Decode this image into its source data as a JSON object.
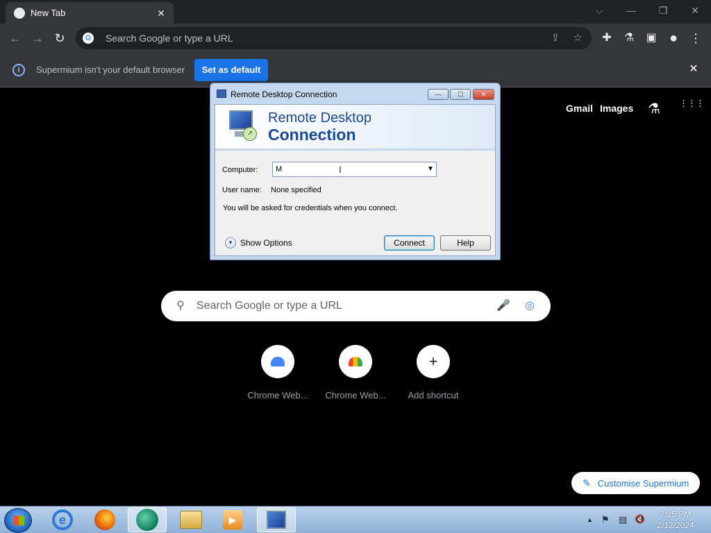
{
  "browser": {
    "tab": {
      "title": "New Tab",
      "close_symbol": "✕"
    },
    "window_controls": {
      "dropdown": "⌵",
      "minimize": "—",
      "restore": "❐",
      "close": "✕"
    },
    "toolbar": {
      "back": "←",
      "forward": "→",
      "reload": "↻",
      "omnibox_placeholder": "Search Google or type a URL",
      "share": "⇪",
      "bookmark": "☆",
      "extensions": "✚",
      "labs": "⚗",
      "sidepanel": "▣",
      "profile": "●",
      "menu": "⋮"
    },
    "infobar": {
      "icon": "i",
      "message": "Supermium isn't your default browser",
      "button": "Set as default",
      "close": "✕"
    }
  },
  "ntp": {
    "links": {
      "gmail": "Gmail",
      "images": "Images"
    },
    "labs_icon": "⚗",
    "apps_icon": "⋮⋮⋮",
    "search": {
      "placeholder": "Search Google or type a URL",
      "icon": "⚲",
      "mic": "🎤",
      "lens": "◎"
    },
    "shortcuts": [
      {
        "label": "Chrome Web..."
      },
      {
        "label": "Chrome Web..."
      },
      {
        "label": "Add shortcut",
        "icon": "+"
      }
    ],
    "customise": {
      "icon": "✎",
      "label": "Customise Supermium"
    }
  },
  "rdp_dialog": {
    "title": "Remote Desktop Connection",
    "min": "—",
    "max": "☐",
    "close": "✕",
    "header_line1": "Remote Desktop",
    "header_line2": "Connection",
    "badge": "↗",
    "computer_label": "Computer:",
    "computer_value": "M",
    "dropdown_arrow": "▼",
    "ibeam": "I",
    "username_label": "User name:",
    "username_value": "None specified",
    "credentials_note": "You will be asked for credentials when you connect.",
    "show_options": "Show Options",
    "show_options_icon": "▼",
    "connect": "Connect",
    "help": "Help"
  },
  "taskbar": {
    "ie_letter": "e",
    "media_icon": "▶",
    "tray": {
      "arrow": "▲",
      "flag": "⚑",
      "network": "▤",
      "volume": "🔇"
    },
    "time": "7:25 PM",
    "date": "2/12/2024"
  }
}
